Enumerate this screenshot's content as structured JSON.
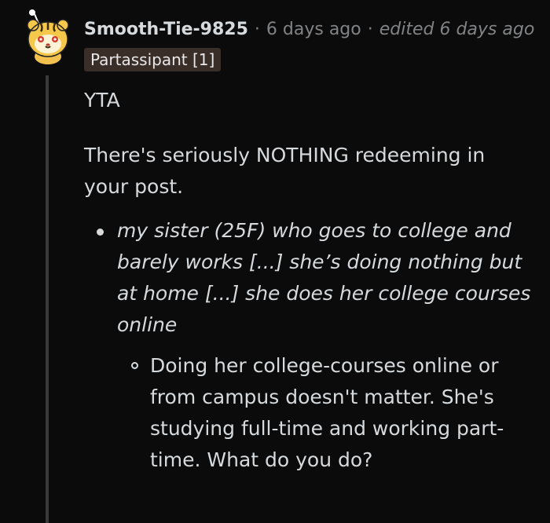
{
  "comment": {
    "author": "Smooth-Tie-9825",
    "time_ago": "6 days ago",
    "edited": "edited 6 days ago",
    "separator": "·",
    "flair": "Partassipant [1]",
    "avatar_icon": "snoo-tiger-avatar-icon",
    "body": {
      "verdict": "YTA",
      "main": "There's seriously NOTHING redeeming in your post.",
      "quote": "my sister (25F) who goes to college and barely works [...] she’s doing nothing but at home [...] she does her college courses online",
      "reply": "Doing her college-courses online or from campus doesn't matter. She's studying full-time and working part-time. What do you do?"
    }
  },
  "colors": {
    "background": "#0b0b0c",
    "text": "#d7dadc",
    "meta": "#818384",
    "flair_bg": "#3a2e28",
    "thread_line": "#3a3a3c"
  }
}
